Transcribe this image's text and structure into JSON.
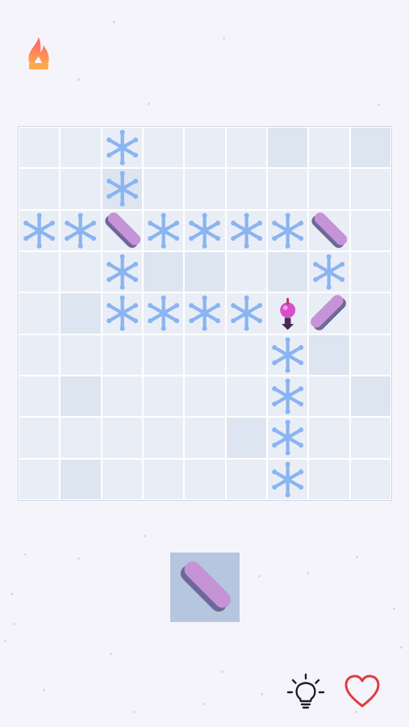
{
  "header": {
    "streak_icon": "flame-icon"
  },
  "board": {
    "rows": 9,
    "cols": 9,
    "colors": {
      "tile_light": "#e9eef6",
      "tile_dark": "#dde5f0",
      "snowflake": "#8ab4f2",
      "bar_top": "#c693d6",
      "bar_side": "#6f6799",
      "player": "#d64fc9"
    },
    "tiles": [
      "lllllldld",
      "lldllllll",
      "lllllllll",
      "lllddldll",
      "ldlllllll",
      "llllllldl",
      "ldlllllld",
      "llllldlll",
      "ldllllllld"
    ],
    "pieces": [
      {
        "r": 0,
        "c": 2,
        "type": "snowflake"
      },
      {
        "r": 1,
        "c": 2,
        "type": "snowflake"
      },
      {
        "r": 2,
        "c": 0,
        "type": "snowflake"
      },
      {
        "r": 2,
        "c": 1,
        "type": "snowflake"
      },
      {
        "r": 2,
        "c": 2,
        "type": "bar-backslash"
      },
      {
        "r": 2,
        "c": 3,
        "type": "snowflake"
      },
      {
        "r": 2,
        "c": 4,
        "type": "snowflake"
      },
      {
        "r": 2,
        "c": 5,
        "type": "snowflake"
      },
      {
        "r": 2,
        "c": 6,
        "type": "snowflake"
      },
      {
        "r": 2,
        "c": 7,
        "type": "bar-backslash"
      },
      {
        "r": 3,
        "c": 2,
        "type": "snowflake"
      },
      {
        "r": 3,
        "c": 7,
        "type": "snowflake"
      },
      {
        "r": 4,
        "c": 2,
        "type": "snowflake"
      },
      {
        "r": 4,
        "c": 3,
        "type": "snowflake"
      },
      {
        "r": 4,
        "c": 4,
        "type": "snowflake"
      },
      {
        "r": 4,
        "c": 5,
        "type": "snowflake"
      },
      {
        "r": 4,
        "c": 6,
        "type": "player"
      },
      {
        "r": 4,
        "c": 7,
        "type": "bar-slash"
      },
      {
        "r": 5,
        "c": 6,
        "type": "snowflake"
      },
      {
        "r": 6,
        "c": 6,
        "type": "snowflake"
      },
      {
        "r": 7,
        "c": 6,
        "type": "snowflake"
      },
      {
        "r": 8,
        "c": 6,
        "type": "snowflake"
      }
    ]
  },
  "tray": {
    "piece": "bar-backslash"
  },
  "footer": {
    "hint_icon": "lightbulb-icon",
    "lives_icon": "heart-icon"
  }
}
